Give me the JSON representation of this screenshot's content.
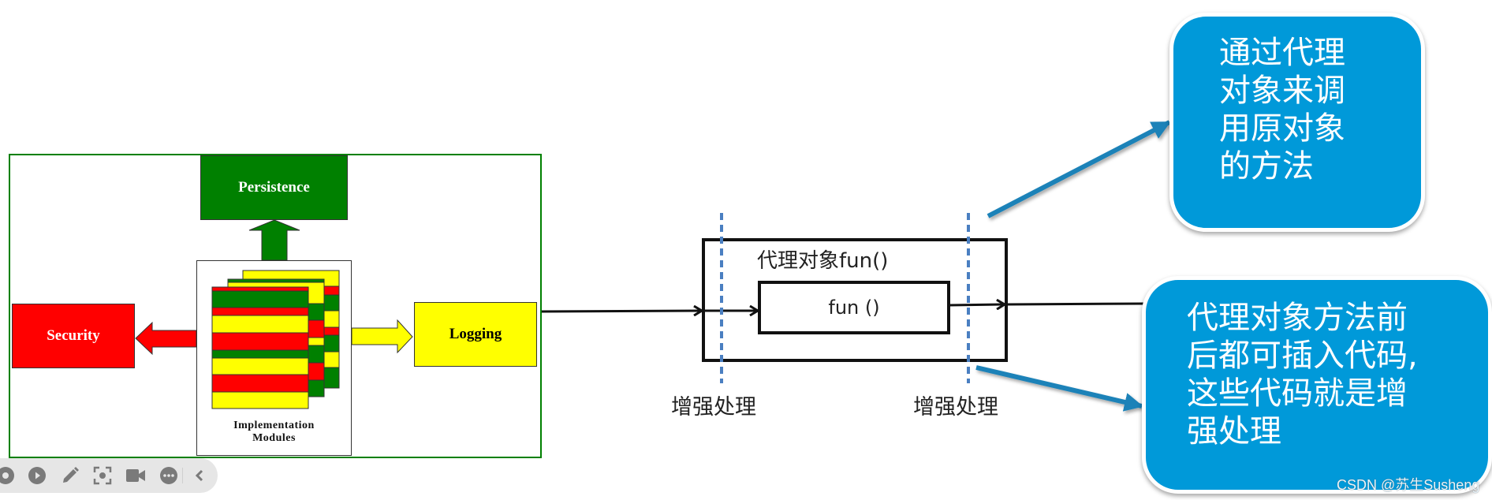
{
  "left_diagram": {
    "modules": {
      "persistence": "Persistence",
      "security": "Security",
      "logging": "Logging"
    },
    "implementation_label_line1": "Implementation",
    "implementation_label_line2": "Modules",
    "colors": {
      "green": "#008000",
      "red": "#ff0000",
      "yellow": "#ffff00"
    }
  },
  "proxy_diagram": {
    "outer_label": "代理对象fun()",
    "inner_label": "fun ()",
    "enhance_left": "增强处理",
    "enhance_right": "增强处理",
    "dash_color": "#4a7fc1"
  },
  "callouts": {
    "top": {
      "lines": [
        "通过代理",
        "对象来调",
        "用原对象",
        "的方法"
      ]
    },
    "bottom": {
      "lines": [
        "代理对象方法前",
        "后都可插入代码,",
        "这些代码就是增",
        "强处理"
      ]
    },
    "bubble_color": "#0099d9",
    "arrow_color": "#1a82b8"
  },
  "watermark": "CSDN @苏生Susheng",
  "toolbar": {
    "icons": [
      "record-icon",
      "play-icon",
      "pencil-icon",
      "screenshot-icon",
      "video-camera-icon",
      "more-icon",
      "collapse-chevron-icon"
    ]
  }
}
